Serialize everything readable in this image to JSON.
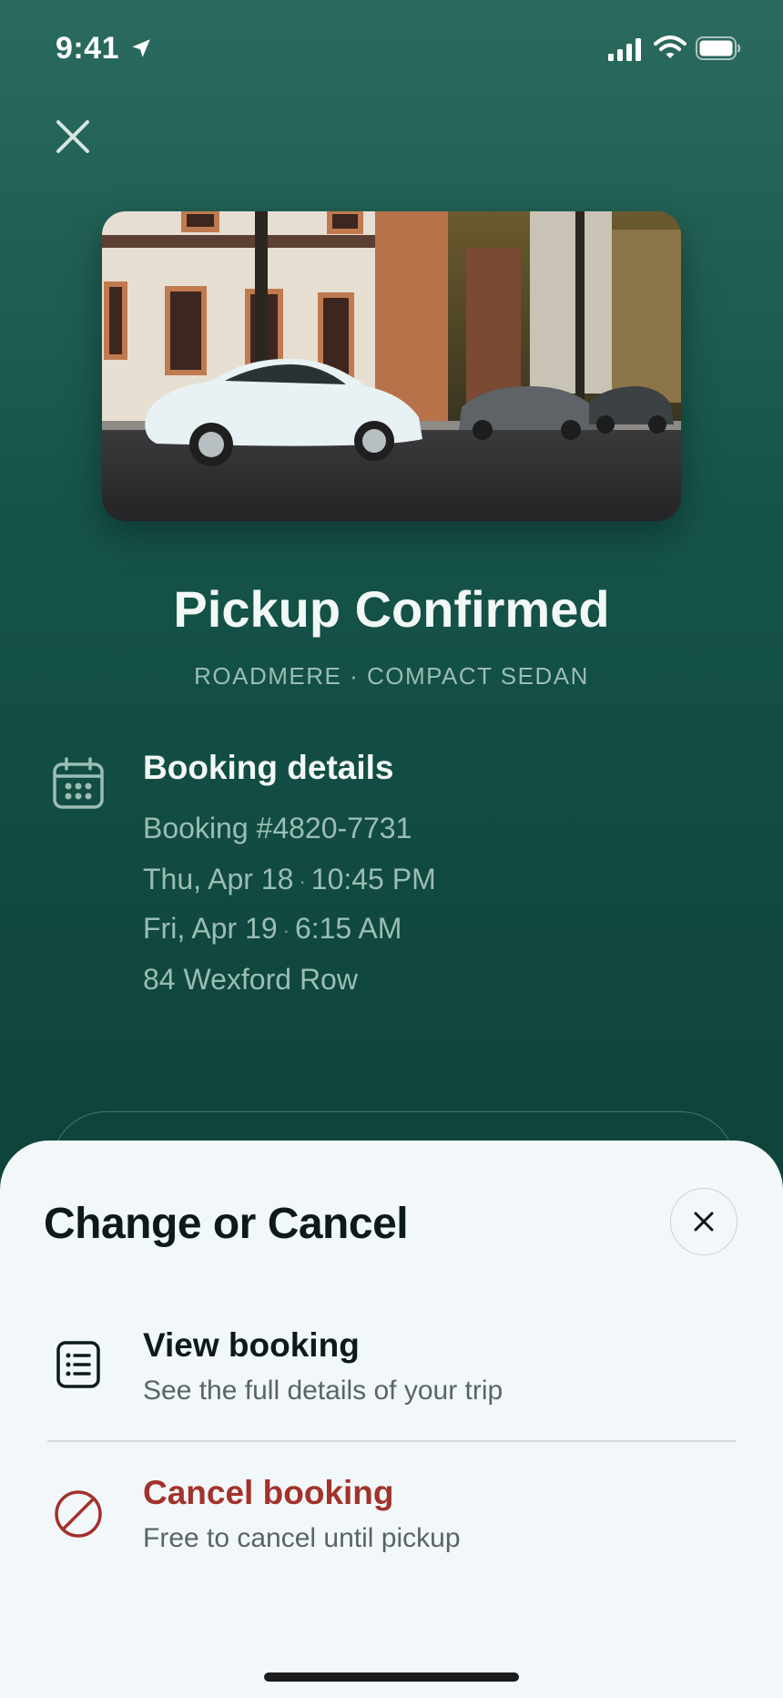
{
  "status": {
    "time": "9:41"
  },
  "hero": {
    "image_alt": "White sedan parked on a city street",
    "colors": {
      "building": "#e5ddd0",
      "road": "#2f2f31"
    }
  },
  "header": {
    "title": "Pickup Confirmed",
    "subtitle": "ROADMERE · COMPACT SEDAN"
  },
  "details": {
    "heading": "Booking details",
    "booking_number": "Booking #4820-7731",
    "pickup_date": "Thu, Apr 18",
    "pickup_time": "10:45 PM",
    "return_date": "Fri, Apr 19",
    "return_time": "6:15 AM",
    "address": "84 Wexford Row",
    "separator": "·"
  },
  "sheet": {
    "title": "Change or Cancel",
    "actions": [
      {
        "title": "View booking",
        "subtitle": "See the full details of your trip",
        "icon": "list-document-icon",
        "color": "#0e1a1a"
      },
      {
        "title": "Cancel booking",
        "subtitle": "Free to cancel until pickup",
        "icon": "prohibited-icon",
        "color": "#a3322a"
      }
    ]
  },
  "colors": {
    "accent_bg": "#155449",
    "sheet_bg": "#f2f8fa",
    "danger": "#a3322a",
    "muted": "#9bbdb4"
  }
}
